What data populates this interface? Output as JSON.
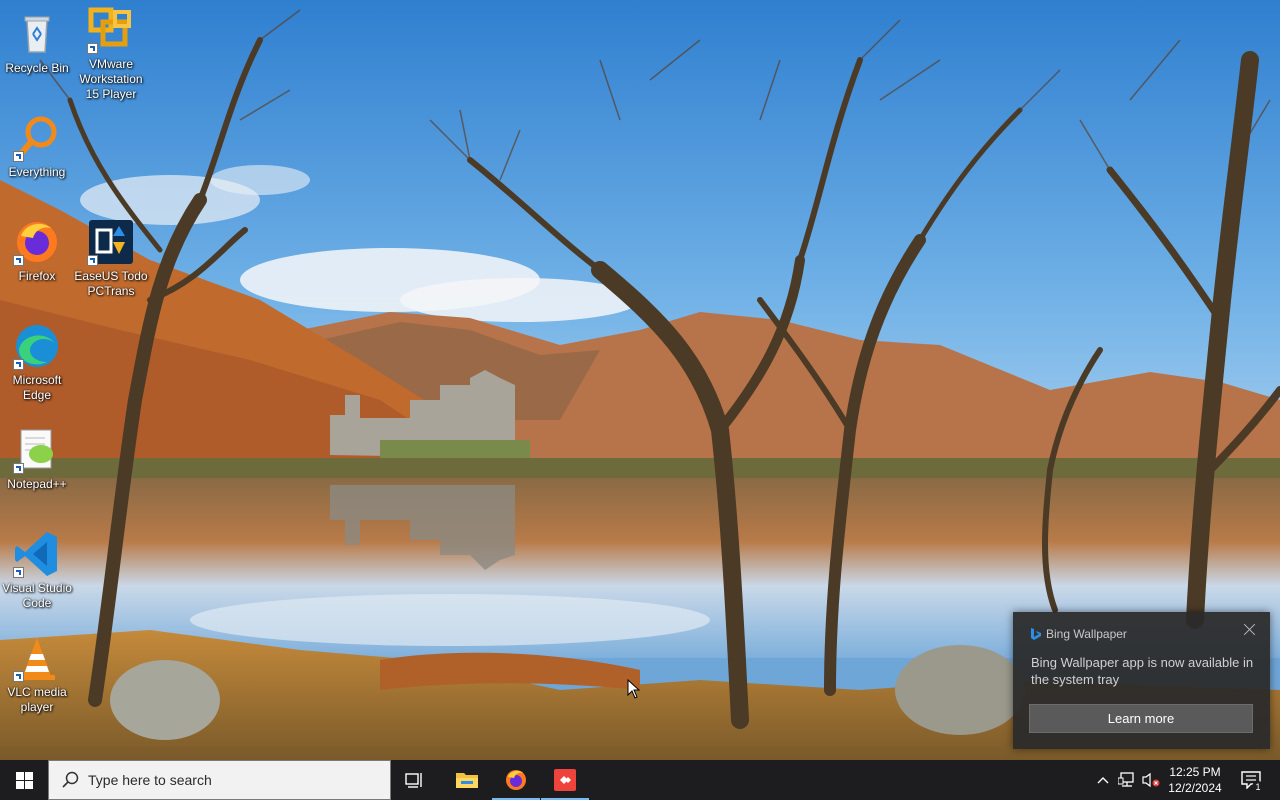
{
  "desktop_icons": [
    {
      "id": "recycle-bin",
      "label": "Recycle Bin"
    },
    {
      "id": "vmware",
      "label": "VMware\nWorkstation\n15 Player"
    },
    {
      "id": "everything",
      "label": "Everything"
    },
    {
      "id": "firefox",
      "label": "Firefox"
    },
    {
      "id": "easeus",
      "label": "EaseUS Todo\nPCTrans"
    },
    {
      "id": "edge",
      "label": "Microsoft\nEdge"
    },
    {
      "id": "notepadpp",
      "label": "Notepad++"
    },
    {
      "id": "vscode",
      "label": "Visual Studio\nCode"
    },
    {
      "id": "vlc",
      "label": "VLC media\nplayer"
    }
  ],
  "toast": {
    "app_name": "Bing Wallpaper",
    "message": "Bing Wallpaper app is now available in the system tray",
    "button_label": "Learn more"
  },
  "taskbar": {
    "search_placeholder": "Type here to search",
    "pinned": [
      "task-view-icon",
      "file-explorer-icon",
      "firefox-icon",
      "anydesk-icon"
    ],
    "clock_time": "12:25 PM",
    "clock_date": "12/2/2024",
    "notification_count": "1"
  },
  "colors": {
    "taskbar_bg": "#1d1d1f",
    "toast_bg": "#2b2b2b",
    "active_indicator": "#7bb8f2",
    "anydesk_red": "#ef443b"
  }
}
